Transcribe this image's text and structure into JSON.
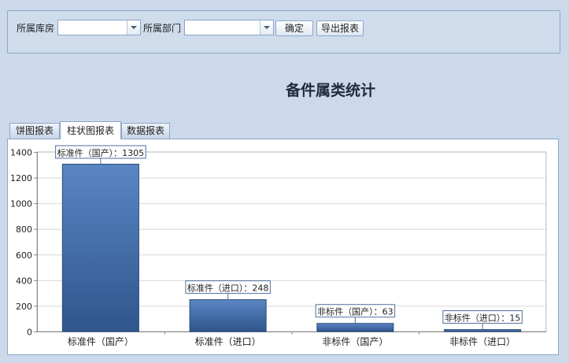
{
  "filters": {
    "warehouse_label": "所属库房",
    "warehouse_value": "",
    "department_label": "所属部门",
    "department_value": "",
    "confirm_label": "确定",
    "export_label": "导出报表"
  },
  "page_title": "备件属类统计",
  "tabs": [
    {
      "label": "饼图报表",
      "active": false
    },
    {
      "label": "柱状图报表",
      "active": true
    },
    {
      "label": "数据报表",
      "active": false
    }
  ],
  "colors": {
    "bar_top": "#5a86c3",
    "bar_bottom": "#2f568c",
    "label_border": "#4d6f9d"
  },
  "chart_data": {
    "type": "bar",
    "categories": [
      "标准件（国产）",
      "标准件（进口）",
      "非标件（国产）",
      "非标件（进口）"
    ],
    "values": [
      1305,
      248,
      63,
      15
    ],
    "data_labels": [
      "标准件（国产）：1305",
      "标准件（进口）：248",
      "非标件（国产）：63",
      "非标件（进口）：15"
    ],
    "ylim": [
      0,
      1400
    ],
    "yticks": [
      0,
      200,
      400,
      600,
      800,
      1000,
      1200,
      1400
    ],
    "grid": true,
    "title": "",
    "xlabel": "",
    "ylabel": ""
  }
}
